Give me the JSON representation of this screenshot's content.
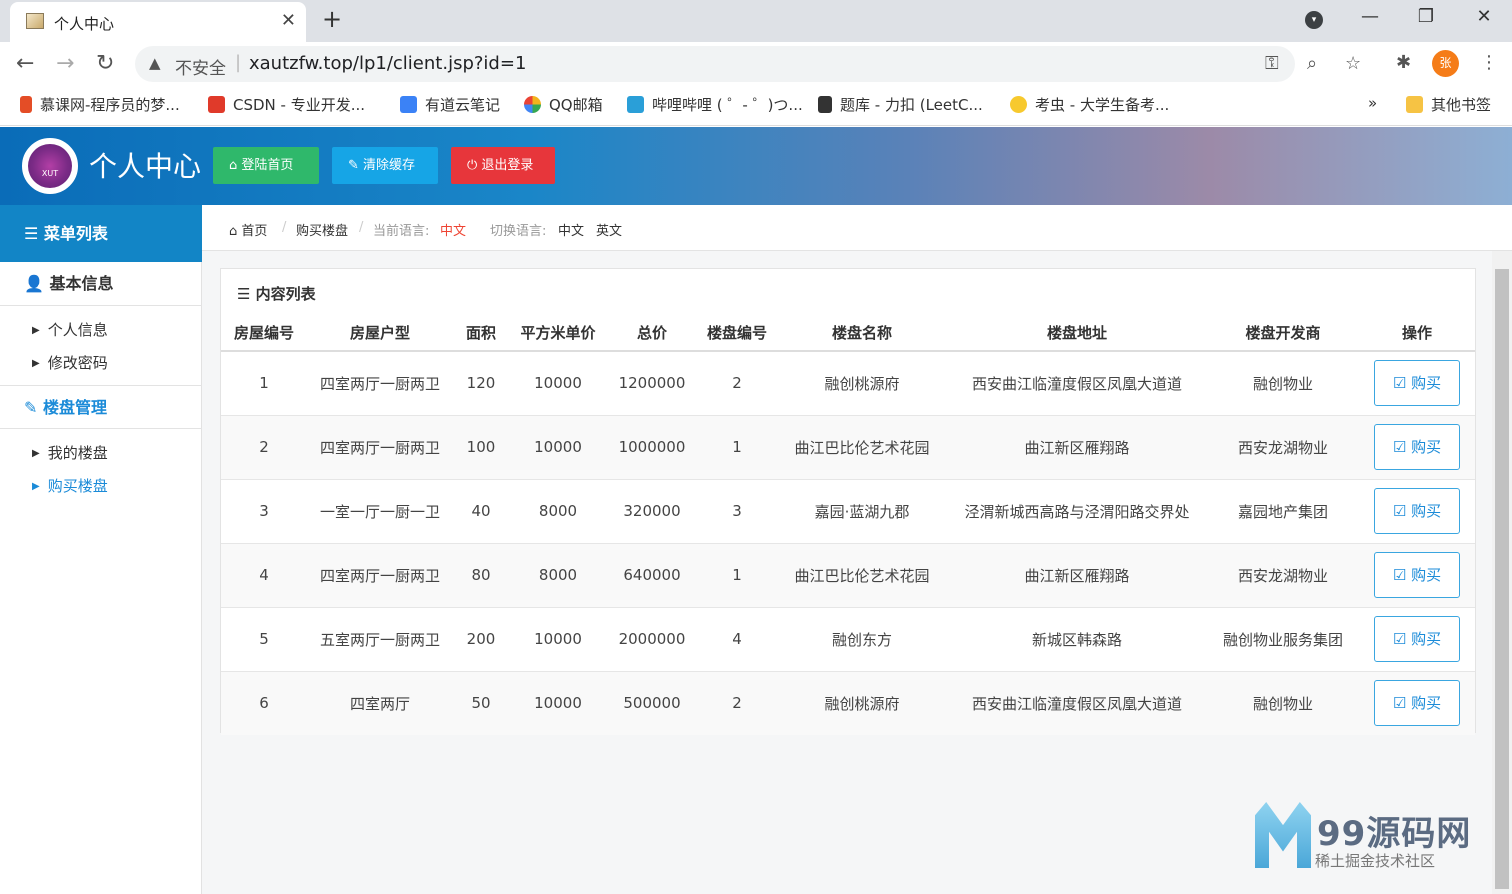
{
  "browser": {
    "tab_title": "个人中心",
    "omnibox": {
      "security_label": "不安全",
      "url": "xautzfw.top/lp1/client.jsp?id=1"
    },
    "profile_initial": "张",
    "bookmarks": [
      {
        "label": "慕课网-程序员的梦...",
        "color": "#e44d26"
      },
      {
        "label": "CSDN - 专业开发...",
        "color": "#e03a2a"
      },
      {
        "label": "有道云笔记",
        "color": "#3b82f6"
      },
      {
        "label": "QQ邮箱",
        "color": "#f2b31d"
      },
      {
        "label": "哔哩哔哩 ( ゜- ゜)つ...",
        "color": "#2a9fd8"
      },
      {
        "label": "题库 - 力扣 (LeetC...",
        "color": "#333333"
      },
      {
        "label": "考虫 - 大学生备考...",
        "color": "#f7c92e"
      }
    ],
    "other_bookmarks": "其他书签"
  },
  "header": {
    "title": "个人中心",
    "logo_text": "XUT",
    "buttons": {
      "home": "登陆首页",
      "clear_cache": "清除缓存",
      "logout": "退出登录"
    }
  },
  "sidebar": {
    "title": "菜单列表",
    "sections": [
      {
        "label": "基本信息",
        "items": [
          "个人信息",
          "修改密码"
        ]
      },
      {
        "label": "楼盘管理",
        "items": [
          "我的楼盘",
          "购买楼盘"
        ]
      }
    ]
  },
  "breadcrumb": {
    "home": "首页",
    "current": "购买楼盘",
    "current_lang_label": "当前语言:",
    "current_lang": "中文",
    "switch_label": "切换语言:",
    "lang_zh": "中文",
    "lang_en": "英文"
  },
  "panel": {
    "title": "内容列表",
    "columns": [
      "房屋编号",
      "房屋户型",
      "面积",
      "平方米单价",
      "总价",
      "楼盘编号",
      "楼盘名称",
      "楼盘地址",
      "楼盘开发商",
      "操作"
    ],
    "buy_label": "购买",
    "rows": [
      [
        "1",
        "四室两厅一厨两卫",
        "120",
        "10000",
        "1200000",
        "2",
        "融创桃源府",
        "西安曲江临潼度假区凤凰大道道",
        "融创物业"
      ],
      [
        "2",
        "四室两厅一厨两卫",
        "100",
        "10000",
        "1000000",
        "1",
        "曲江巴比伦艺术花园",
        "曲江新区雁翔路",
        "西安龙湖物业"
      ],
      [
        "3",
        "一室一厅一厨一卫",
        "40",
        "8000",
        "320000",
        "3",
        "嘉园·蓝湖九郡",
        "泾渭新城西高路与泾渭阳路交界处",
        "嘉园地产集团"
      ],
      [
        "4",
        "四室两厅一厨两卫",
        "80",
        "8000",
        "640000",
        "1",
        "曲江巴比伦艺术花园",
        "曲江新区雁翔路",
        "西安龙湖物业"
      ],
      [
        "5",
        "五室两厅一厨两卫",
        "200",
        "10000",
        "2000000",
        "4",
        "融创东方",
        "新城区韩森路",
        "融创物业服务集团"
      ],
      [
        "6",
        "四室两厅",
        "50",
        "10000",
        "500000",
        "2",
        "融创桃源府",
        "西安曲江临潼度假区凤凰大道道",
        "融创物业"
      ]
    ]
  },
  "watermark": {
    "brand": "99源码网",
    "sub": "稀土掘金技术社区"
  }
}
